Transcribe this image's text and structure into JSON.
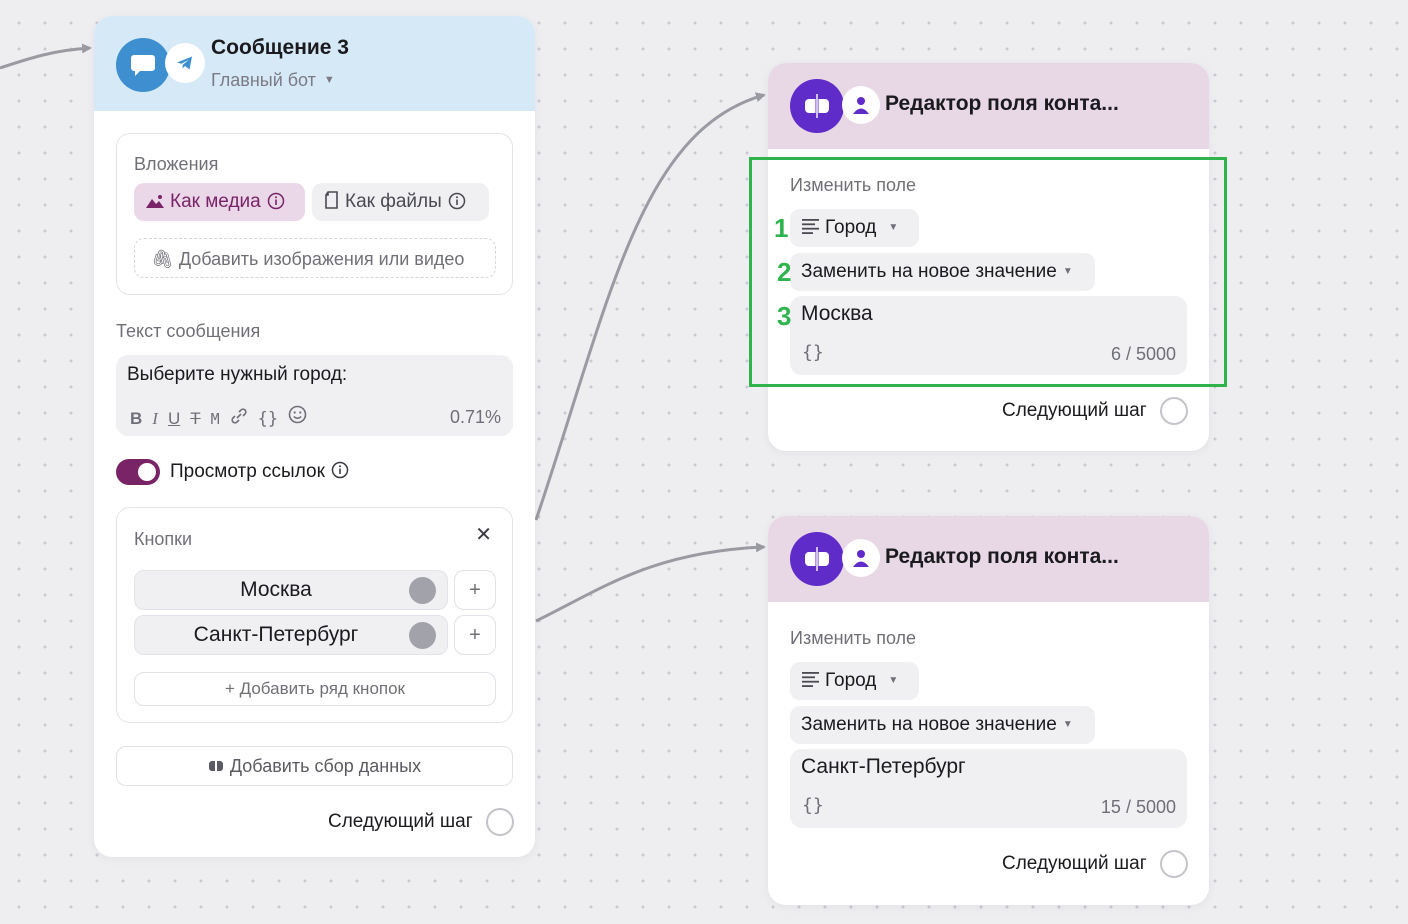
{
  "message_card": {
    "title": "Сообщение 3",
    "bot_name": "Главный бот",
    "attachments": {
      "label": "Вложения",
      "as_media": "Как медиа",
      "as_files": "Как файлы",
      "add_media": "Добавить изображения или видео"
    },
    "text_label": "Текст сообщения",
    "text_value": "Выберите нужный город:",
    "format_tools": [
      "B",
      "I",
      "U",
      "T",
      "M",
      "link",
      "{}",
      "emoji"
    ],
    "text_usage": "0.71%",
    "link_preview": {
      "label": "Просмотр ссылок",
      "enabled": true
    },
    "buttons": {
      "label": "Кнопки",
      "items": [
        "Москва",
        "Санкт-Петербург"
      ],
      "add_row": "+ Добавить ряд кнопок"
    },
    "add_data_collection": "Добавить сбор данных",
    "next_step": "Следующий шаг"
  },
  "editors": [
    {
      "title": "Редактор поля конта...",
      "change_label": "Изменить поле",
      "field": "Город",
      "mode": "Заменить на новое значение",
      "value": "Москва",
      "counter": "6 / 5000",
      "braces": "{}",
      "next_step": "Следующий шаг"
    },
    {
      "title": "Редактор поля конта...",
      "change_label": "Изменить поле",
      "field": "Город",
      "mode": "Заменить на новое значение",
      "value": "Санкт-Петербург",
      "counter": "15 / 5000",
      "braces": "{}",
      "next_step": "Следующий шаг"
    }
  ],
  "annotations": {
    "steps": [
      "1",
      "2",
      "3"
    ],
    "color": "#2fb34d"
  },
  "colors": {
    "canvas": "#eeeef1",
    "message_header": "#d6e9f6",
    "editor_header": "#e8d8e6",
    "accent_purple": "#7a2468",
    "editor_icon": "#5f2bc9",
    "message_icon": "#3d8fd0"
  }
}
